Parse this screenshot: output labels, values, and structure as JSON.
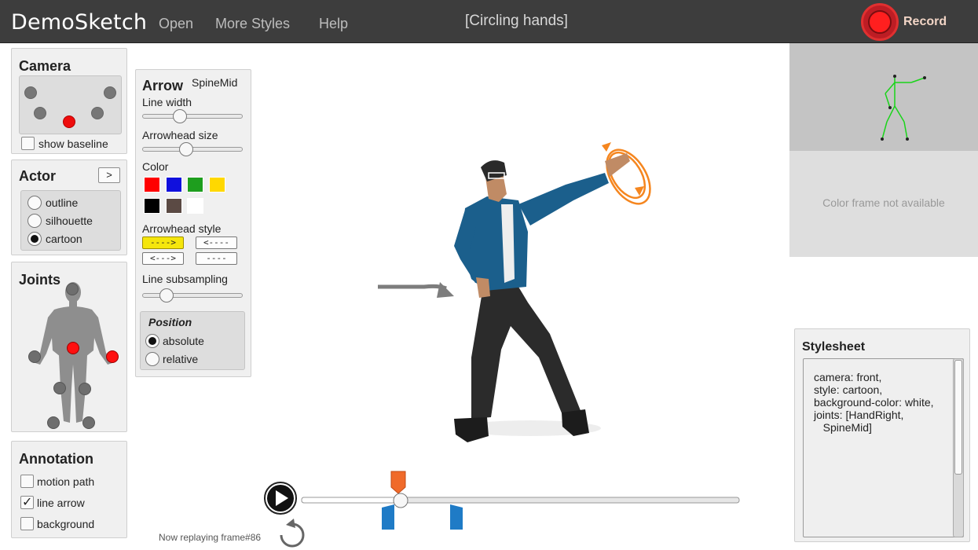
{
  "app": {
    "title": "DemoSketch",
    "menu": [
      "Open",
      "More Styles",
      "Help"
    ],
    "clip_title": "[Circling hands]",
    "record_label": "Record"
  },
  "camera": {
    "title": "Camera",
    "baseline_label": "show baseline",
    "baseline_checked": false
  },
  "actor": {
    "title": "Actor",
    "next_label": ">",
    "options": [
      "outline",
      "silhouette",
      "cartoon"
    ],
    "selected": "cartoon"
  },
  "joints": {
    "title": "Joints"
  },
  "annotation": {
    "title": "Annotation",
    "items": [
      {
        "label": "motion path",
        "checked": false
      },
      {
        "label": "line arrow",
        "checked": true
      },
      {
        "label": "background",
        "checked": false
      }
    ]
  },
  "arrow": {
    "title": "Arrow",
    "joint": "SpineMid",
    "line_width_label": "Line width",
    "line_width_value": 0.35,
    "arrowhead_size_label": "Arrowhead size",
    "arrowhead_size_value": 0.43,
    "color_label": "Color",
    "colors": [
      "#ff0000",
      "#1010dd",
      "#1e9e1e",
      "#ffd800",
      "#000000",
      "#5b4a44",
      "#ffffff"
    ],
    "arrowhead_style_label": "Arrowhead style",
    "arrowhead_styles": [
      "---->",
      "<----",
      "<--->",
      "----"
    ],
    "arrowhead_style_selected": "---->",
    "line_subsampling_label": "Line subsampling",
    "line_subsampling_value": 0.2,
    "position_label": "Position",
    "position_options": [
      "absolute",
      "relative"
    ],
    "position_selected": "absolute"
  },
  "player": {
    "status": "Now replaying frame#86",
    "progress": 0.22
  },
  "preview": {
    "color_frame_text": "Color frame not available"
  },
  "stylesheet": {
    "title": "Stylesheet",
    "text": "camera: front,\nstyle: cartoon,\nbackground-color: white,\njoints: [HandRight,\n   SpineMid]"
  },
  "colors": {
    "topbar": "#3d3d3d",
    "record": "#ff1f1f",
    "selected_dot": "#ee0c0c",
    "arrow_orange": "#f5861f",
    "jacket_blue": "#1b5f8c",
    "timeline_marker_orange": "#f06a2a",
    "timeline_marker_blue": "#1f7bc6"
  }
}
